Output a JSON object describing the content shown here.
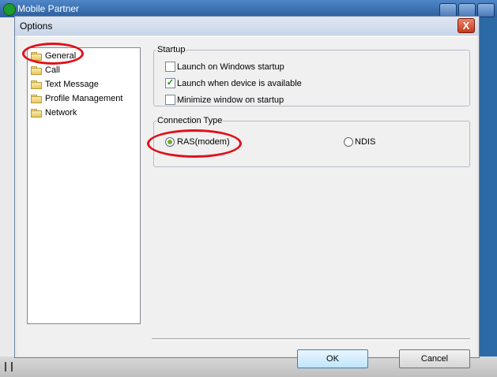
{
  "app": {
    "title": "Mobile Partner"
  },
  "dialog": {
    "title": "Options",
    "close_glyph": "X",
    "nav": [
      {
        "label": "General",
        "selected": true
      },
      {
        "label": "Call"
      },
      {
        "label": "Text Message"
      },
      {
        "label": "Profile Management"
      },
      {
        "label": "Network"
      }
    ],
    "startup": {
      "legend": "Startup",
      "options": [
        {
          "label": "Launch on Windows startup",
          "checked": false
        },
        {
          "label": "Launch when device is available",
          "checked": true
        },
        {
          "label": "Minimize window on startup",
          "checked": false
        }
      ]
    },
    "connection": {
      "legend": "Connection Type",
      "options": [
        {
          "label": "RAS(modem)",
          "selected": true
        },
        {
          "label": "NDIS",
          "selected": false
        }
      ]
    },
    "buttons": {
      "ok": "OK",
      "cancel": "Cancel"
    }
  },
  "colors": {
    "annotation": "#e0101a",
    "check": "#1a8a1a",
    "radio_dot": "#6cae2b"
  }
}
